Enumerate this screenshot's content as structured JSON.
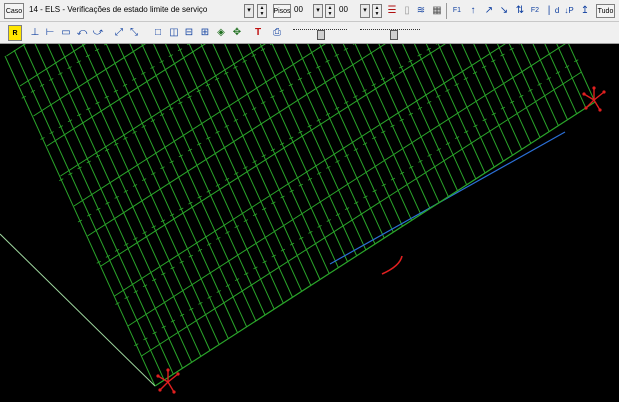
{
  "toolbar1": {
    "case_button": "Caso",
    "case_value": "14 - ELS - Verificações de estado limite de serviço",
    "pisos_button": "Pisos",
    "floor_from": "00",
    "floor_to": "00",
    "f1_label": "F1",
    "f2_label": "F2",
    "fd_label": "d",
    "p_label": "P",
    "tudo_button": "Tudo"
  },
  "toolbar2": {
    "r_button": "R"
  },
  "canvas": {
    "background": "#000000",
    "grid_color": "#2aa52a",
    "edge_color": "#2b6fd6",
    "support_color": "#e02020"
  }
}
